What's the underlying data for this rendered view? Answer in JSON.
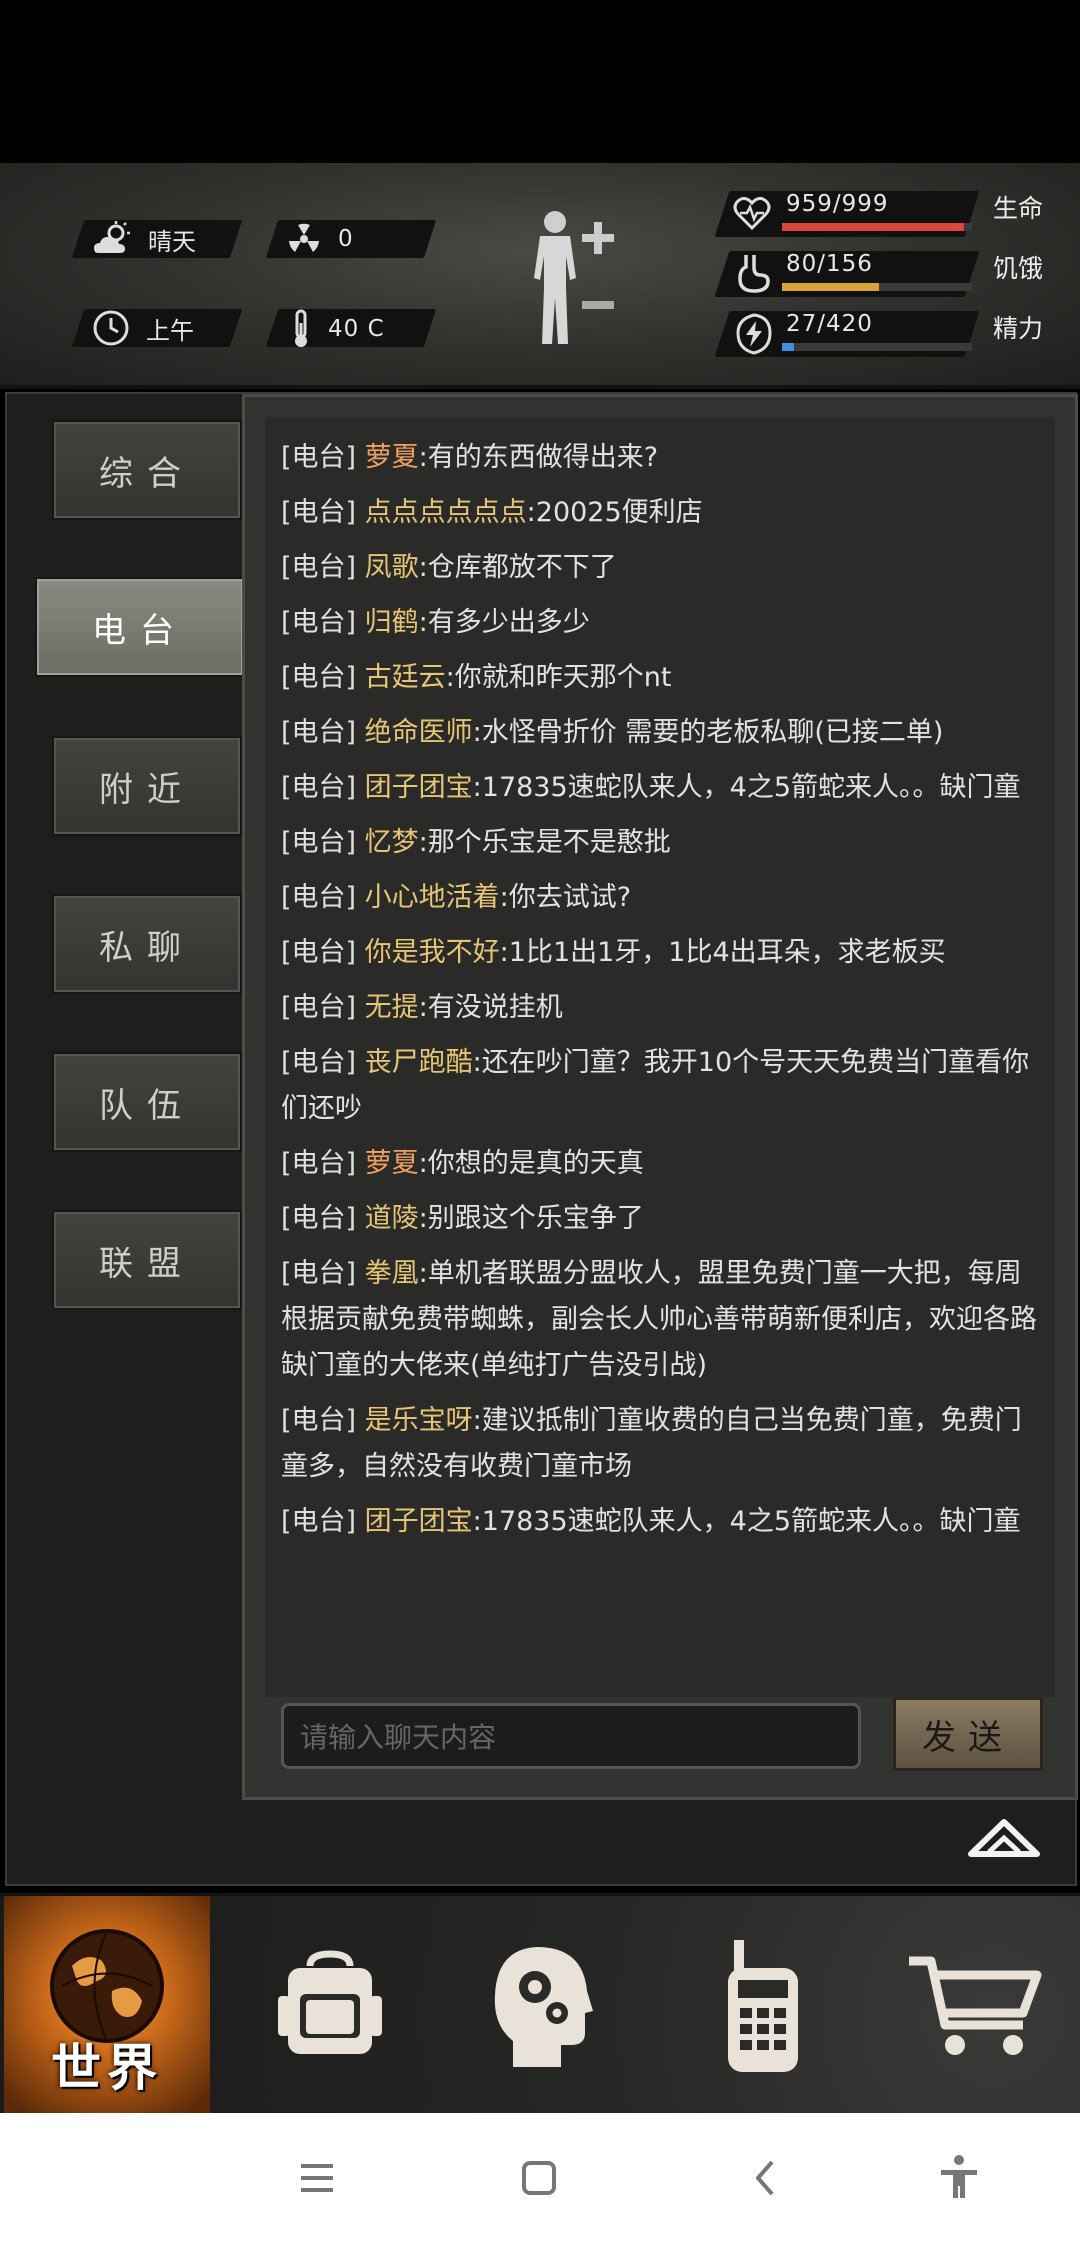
{
  "stats": {
    "weather": "晴天",
    "radiation": "0",
    "time_of_day": "上午",
    "temperature": "40 C",
    "health": {
      "text": "959/999",
      "label": "生命",
      "fraction": 0.96,
      "color": "#d9473c"
    },
    "hunger": {
      "text": "80/156",
      "label": "饥饿",
      "fraction": 0.51,
      "color": "#d9a435"
    },
    "energy": {
      "text": "27/420",
      "label": "精力",
      "fraction": 0.064,
      "color": "#3e8fe0"
    }
  },
  "tabs": [
    {
      "label": "综合",
      "active": false
    },
    {
      "label": "电台",
      "active": true
    },
    {
      "label": "附近",
      "active": false
    },
    {
      "label": "私聊",
      "active": false
    },
    {
      "label": "队伍",
      "active": false
    },
    {
      "label": "联盟",
      "active": false
    }
  ],
  "channel_tag": "[电台]",
  "messages": [
    {
      "name": "萝夏",
      "text": ":有的东西做得出来?",
      "name_color": "orange"
    },
    {
      "name": "点点点点点点",
      "text": ":20025便利店",
      "name_color": "gold"
    },
    {
      "name": "凤歌",
      "text": ":仓库都放不下了",
      "name_color": "gold"
    },
    {
      "name": "归鹤",
      "text": ":有多少出多少",
      "name_color": "gold"
    },
    {
      "name": "古廷云",
      "text": ":你就和昨天那个nt",
      "name_color": "gold"
    },
    {
      "name": "绝命医师",
      "text": ":水怪骨折价 需要的老板私聊(已接二单)",
      "name_color": "gold"
    },
    {
      "name": "团子团宝",
      "text": ":17835速蛇队来人，4之5箭蛇来人。。缺门童",
      "name_color": "gold"
    },
    {
      "name": "忆梦",
      "text": ":那个乐宝是不是憨批",
      "name_color": "gold"
    },
    {
      "name": "小心地活着",
      "text": ":你去试试?",
      "name_color": "gold"
    },
    {
      "name": "你是我不好",
      "text": ":1比1出1牙，1比4出耳朵，求老板买",
      "name_color": "gold"
    },
    {
      "name": "无提",
      "text": ":有没说挂机",
      "name_color": "gold"
    },
    {
      "name": "丧尸跑酷",
      "text": ":还在吵门童？我开10个号天天免费当门童看你们还吵",
      "name_color": "gold"
    },
    {
      "name": "萝夏",
      "text": ":你想的是真的天真",
      "name_color": "orange"
    },
    {
      "name": "道陵",
      "text": ":别跟这个乐宝争了",
      "name_color": "gold"
    },
    {
      "name": "拳凰",
      "text": ":单机者联盟分盟收人，盟里免费门童一大把，每周根据贡献免费带蜘蛛，副会长人帅心善带萌新便利店，欢迎各路缺门童的大佬来(单纯打广告没引战)",
      "name_color": "gold"
    },
    {
      "name": "是乐宝呀",
      "text": ":建议抵制门童收费的自己当免费门童，免费门童多，自然没有收费门童市场",
      "name_color": "gold"
    },
    {
      "name": "团子团宝",
      "text": ":17835速蛇队来人，4之5箭蛇来人。。缺门童",
      "name_color": "gold"
    }
  ],
  "chat_input": {
    "placeholder": "请输入聊天内容",
    "value": ""
  },
  "send_label": "发送",
  "nav": {
    "world_label": "世界"
  },
  "colors": {
    "name_gold": "#e6c574",
    "name_orange": "#f0a060",
    "accent_orange": "#e38a2a"
  }
}
